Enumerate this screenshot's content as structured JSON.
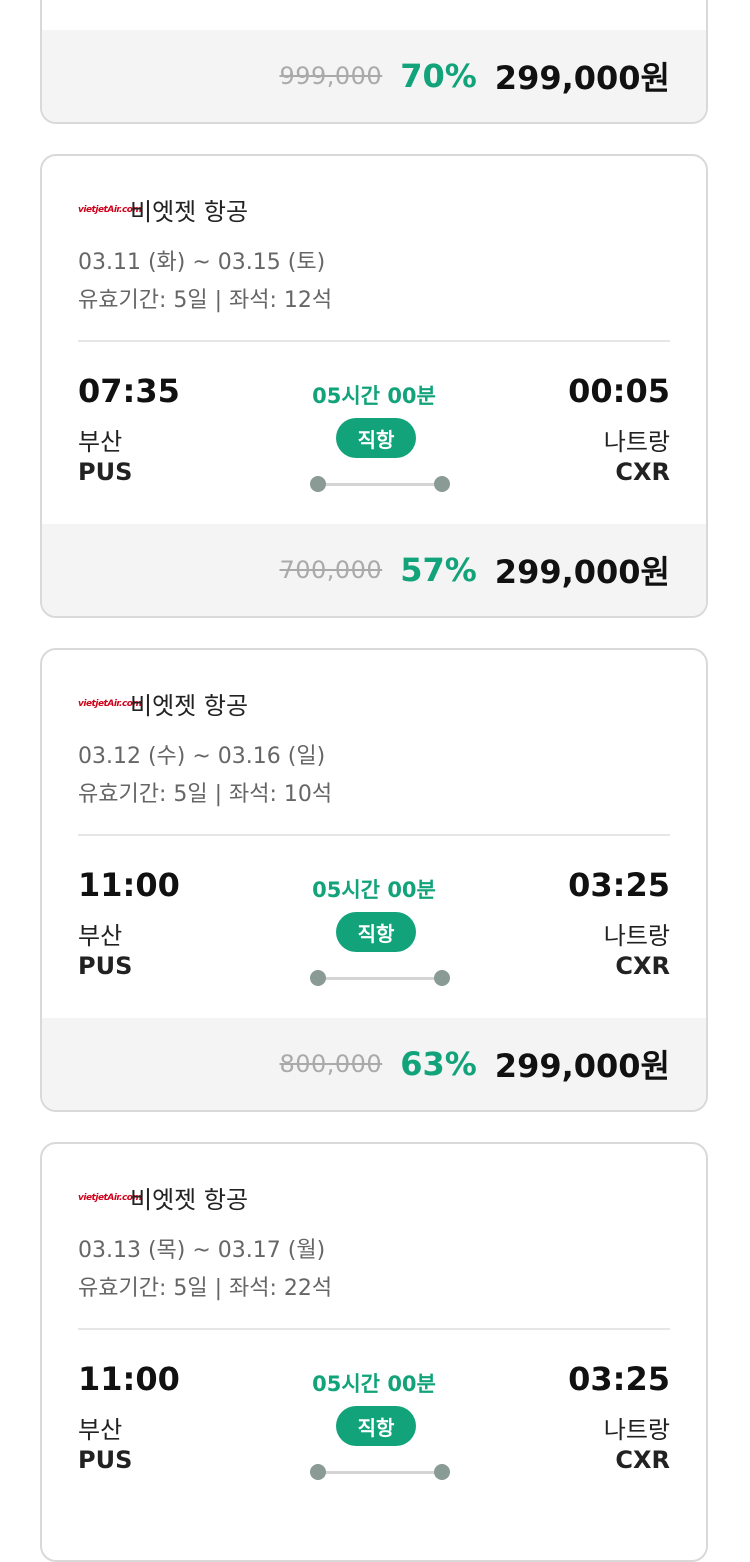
{
  "cards": [
    {
      "old_price": "999,000",
      "discount": "70%",
      "price": "299,000원"
    },
    {
      "logo": "vietjetAir.com",
      "airline": "비엣젯 항공",
      "dates": "03.11 (화) ~ 03.15 (토)",
      "validity": "유효기간: 5일 | 좌석: 12석",
      "dep_time": "07:35",
      "dep_city": "부산",
      "dep_code": "PUS",
      "duration": "05시간 00분",
      "flight_type": "직항",
      "arr_time": "00:05",
      "arr_city": "나트랑",
      "arr_code": "CXR",
      "old_price": "700,000",
      "discount": "57%",
      "price": "299,000원"
    },
    {
      "logo": "vietjetAir.com",
      "airline": "비엣젯 항공",
      "dates": "03.12 (수) ~ 03.16 (일)",
      "validity": "유효기간: 5일 | 좌석: 10석",
      "dep_time": "11:00",
      "dep_city": "부산",
      "dep_code": "PUS",
      "duration": "05시간 00분",
      "flight_type": "직항",
      "arr_time": "03:25",
      "arr_city": "나트랑",
      "arr_code": "CXR",
      "old_price": "800,000",
      "discount": "63%",
      "price": "299,000원"
    },
    {
      "logo": "vietjetAir.com",
      "airline": "비엣젯 항공",
      "dates": "03.13 (목) ~ 03.17 (월)",
      "validity": "유효기간: 5일 | 좌석: 22석",
      "dep_time": "11:00",
      "dep_city": "부산",
      "dep_code": "PUS",
      "duration": "05시간 00분",
      "flight_type": "직항",
      "arr_time": "03:25",
      "arr_city": "나트랑",
      "arr_code": "CXR"
    }
  ],
  "colors": {
    "accent": "#12a37a",
    "price_bar_bg": "#f4f4f4",
    "card_border": "#d9d9d9",
    "logo_red": "#d0021b"
  }
}
